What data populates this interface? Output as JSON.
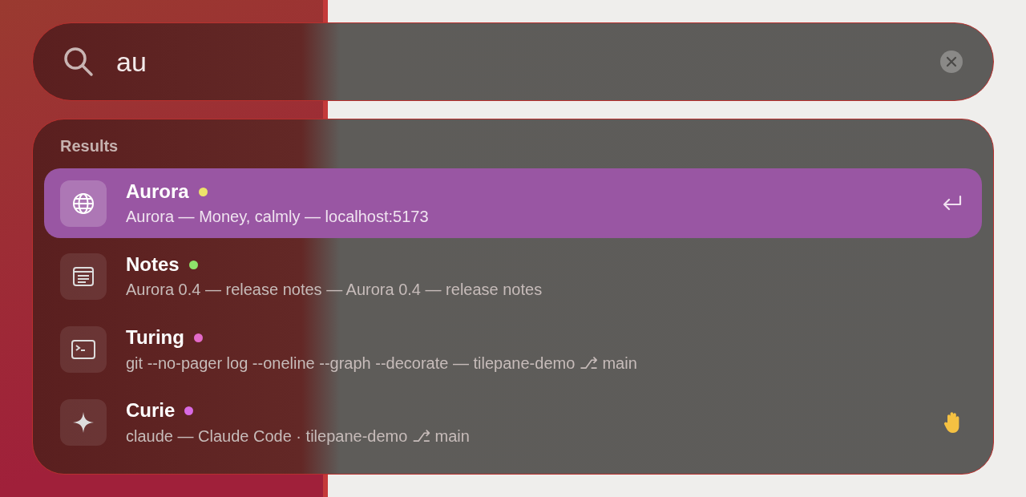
{
  "search": {
    "value": "au"
  },
  "results": {
    "heading": "Results",
    "items": [
      {
        "kind": "web",
        "title": "Aurora",
        "subtitle": "Aurora — Money, calmly — localhost:5173",
        "color": "#ece36a",
        "selected": true,
        "hand_raised": false
      },
      {
        "kind": "notes",
        "title": "Notes",
        "subtitle": "Aurora 0.4 — release notes — Aurora 0.4 — release notes",
        "color": "#8ee36a",
        "selected": false,
        "hand_raised": false
      },
      {
        "kind": "terminal",
        "title": "Turing",
        "subtitle": "git --no-pager log --oneline --graph --decorate — tilepane-demo ⎇ main",
        "color": "#e36ac8",
        "selected": false,
        "hand_raised": false
      },
      {
        "kind": "sparkle",
        "title": "Curie",
        "subtitle": "claude — Claude Code · tilepane-demo ⎇ main",
        "color": "#d86ae3",
        "selected": false,
        "hand_raised": true
      }
    ]
  }
}
